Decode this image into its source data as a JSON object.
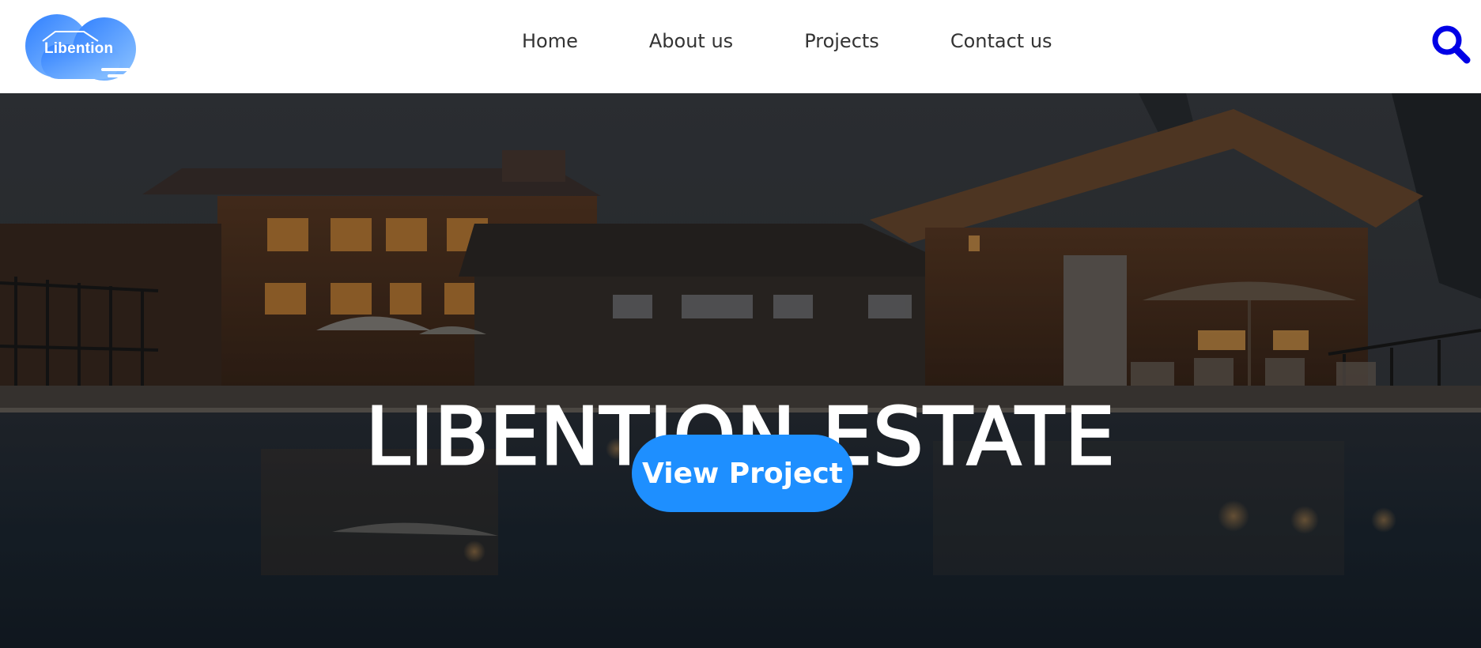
{
  "header": {
    "logo_text": "Libention",
    "nav": [
      {
        "label": "Home"
      },
      {
        "label": "About us"
      },
      {
        "label": "Projects"
      },
      {
        "label": "Contact us"
      }
    ],
    "search_icon": "search-icon"
  },
  "hero": {
    "title": "LIBENTION ESTATE",
    "cta_label": "View Project"
  },
  "colors": {
    "accent": "#1e8fff",
    "search_icon": "#0000e6",
    "logo_gradient_start": "#2f7fff",
    "logo_gradient_end": "#7ab8ff"
  }
}
